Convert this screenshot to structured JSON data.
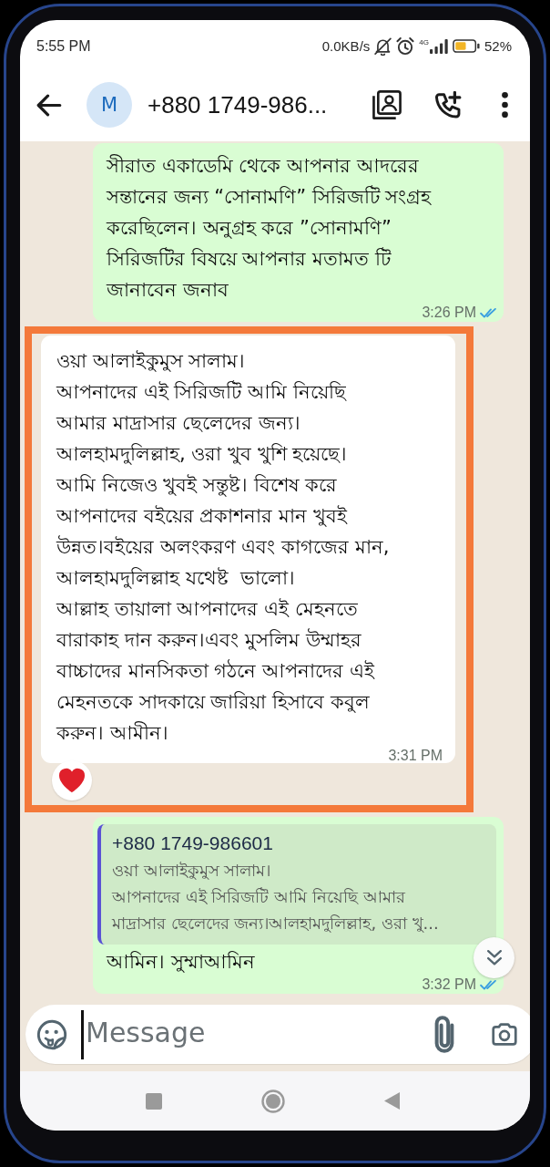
{
  "status_bar": {
    "time": "5:55 PM",
    "net_speed": "0.0KB/s",
    "network": "4G",
    "battery": "52%"
  },
  "header": {
    "avatar_letter": "M",
    "title": "+880 1749-986..."
  },
  "messages": [
    {
      "kind": "outgoing",
      "text": "সীরাত একাডেমি থেকে আপনার আদরের\nসন্তানের জন্য “সোনামণি” সিরিজটি সংগ্রহ\nকরেছিলেন। অনুগ্রহ করে ”সোনামণি”\nসিরিজটির বিষয়ে আপনার মতামত টি\nজানাবেন জনাব",
      "time": "3:26 PM",
      "read": true
    },
    {
      "kind": "incoming",
      "highlighted": true,
      "text": "ওয়া আলাইকুমুস সালাম।\nআপনাদের এই সিরিজটি আমি নিয়েছি\nআমার মাদ্রাসার ছেলেদের জন্য।\nআলহামদুলিল্লাহ, ওরা খুব খুশি হয়েছে।\nআমি নিজেও খুবই সন্তুষ্ট। বিশেষ করে\nআপনাদের বইয়ের প্রকাশনার মান খুবই\nউন্নত।বইয়ের অলংকরণ এবং কাগজের মান,\nআলহামদুলিল্লাহ যথেষ্ট  ভালো।\nআল্লাহ তায়ালা আপনাদের এই মেহনতে\nবারাকাহ দান করুন।এবং মুসলিম উম্মাহর\nবাচ্চাদের মানসিকতা গঠনে আপনাদের এই\nমেহনতকে সাদকায়ে জারিয়া হিসাবে কবুল\nকরুন। আমীন।",
      "time": "3:31 PM",
      "reaction": true
    },
    {
      "kind": "outgoing",
      "quote": {
        "author": "+880 1749-986601",
        "text": "ওয়া আলাইকুমুস সালাম।\nআপনাদের এই সিরিজটি আমি নিয়েছি আমার\nমাদ্রাসার ছেলেদের জন্য।আলহামদুলিল্লাহ, ওরা খু..."
      },
      "text": "আমিন। সুম্মাআমিন",
      "time": "3:32 PM",
      "read": true
    }
  ],
  "composer": {
    "placeholder": "Message"
  }
}
